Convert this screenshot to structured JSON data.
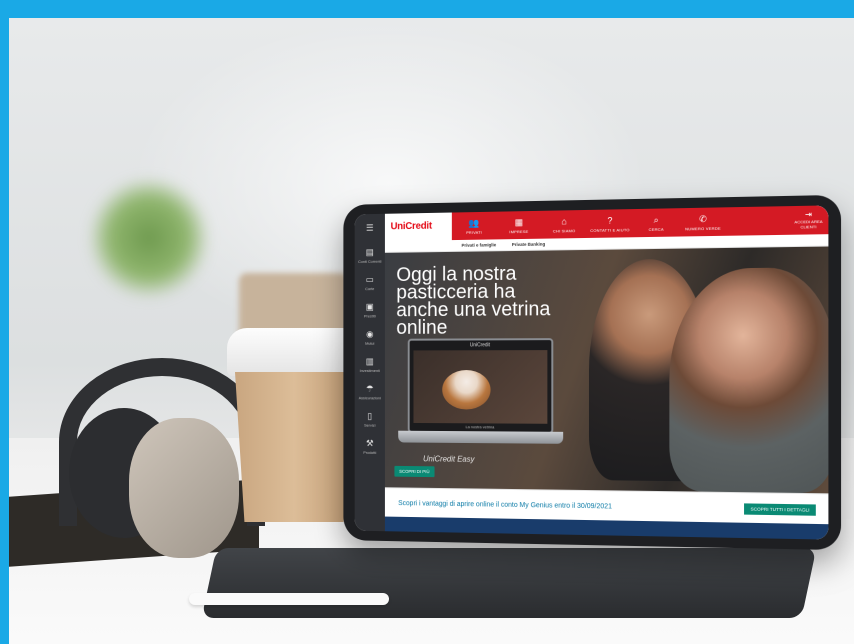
{
  "brand": {
    "logo_text": "UniCredit",
    "accent": "#d41a24",
    "frame_color": "#1aa9e6"
  },
  "sidebar": {
    "items": [
      {
        "icon": "menu-icon",
        "label": ""
      },
      {
        "icon": "document-icon",
        "label": "Conti Correnti"
      },
      {
        "icon": "card-icon",
        "label": "Carte"
      },
      {
        "icon": "card-icon",
        "label": "Prestiti"
      },
      {
        "icon": "shield-icon",
        "label": "Mutui"
      },
      {
        "icon": "chart-icon",
        "label": "Investimenti"
      },
      {
        "icon": "umbrella-icon",
        "label": "Assicurazioni"
      },
      {
        "icon": "phone-icon",
        "label": "Servizi"
      },
      {
        "icon": "tool-icon",
        "label": "Prodotti"
      }
    ]
  },
  "nav": {
    "items": [
      {
        "icon": "people-icon",
        "label": "PRIVATI"
      },
      {
        "icon": "business-icon",
        "label": "IMPRESE"
      },
      {
        "icon": "bank-icon",
        "label": "CHI SIAMO"
      },
      {
        "icon": "help-icon",
        "label": "CONTATTI E AIUTO"
      },
      {
        "icon": "search-icon",
        "label": "CERCA"
      },
      {
        "icon": "phone-icon",
        "label": "NUMERO VERDE"
      }
    ],
    "login_label": "ACCEDI AREA CLIENTI"
  },
  "subnav": {
    "items": [
      "Privati e famiglie",
      "Private Banking"
    ]
  },
  "hero": {
    "title": "Oggi la nostra pasticceria ha anche una vetrina online",
    "laptop_brand": "UniCredit",
    "laptop_caption": "La nostra vetrina",
    "caption": "UniCredit Easy",
    "cta": "SCOPRI DI PIÙ"
  },
  "promo": {
    "text": "Scopri i vantaggi di aprire online il conto My Genius entro il 30/09/2021",
    "button": "SCOPRI TUTTI I DETTAGLI"
  }
}
